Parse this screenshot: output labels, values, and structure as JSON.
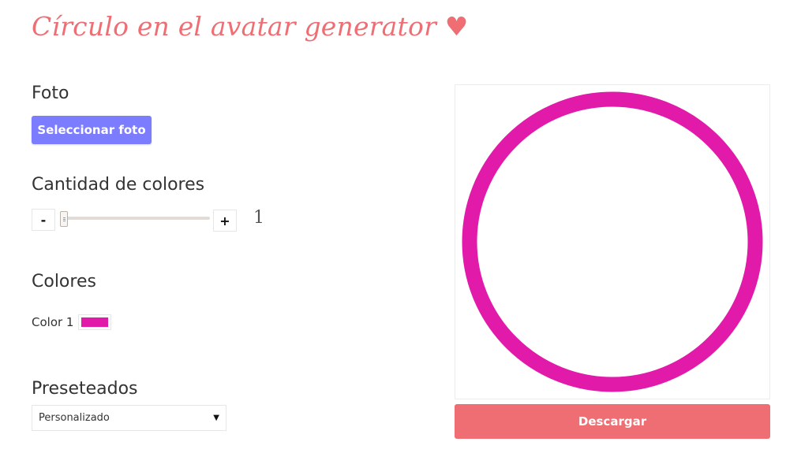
{
  "page": {
    "title": "Círculo en el avatar generator ♥",
    "accent_color": "#ee6e73"
  },
  "foto": {
    "section_title": "Foto",
    "select_button": "Seleccionar foto",
    "button_color": "#7c7cff"
  },
  "cantidad": {
    "section_title": "Cantidad de colores",
    "minus_label": "-",
    "plus_label": "+",
    "value": "1"
  },
  "colores": {
    "section_title": "Colores",
    "items": [
      {
        "label": "Color 1",
        "color": "#e21aaa"
      }
    ]
  },
  "presets": {
    "section_title": "Preseteados",
    "selected": "Personalizado"
  },
  "preview": {
    "ring_color": "#e21aaa"
  },
  "download": {
    "label": "Descargar"
  }
}
